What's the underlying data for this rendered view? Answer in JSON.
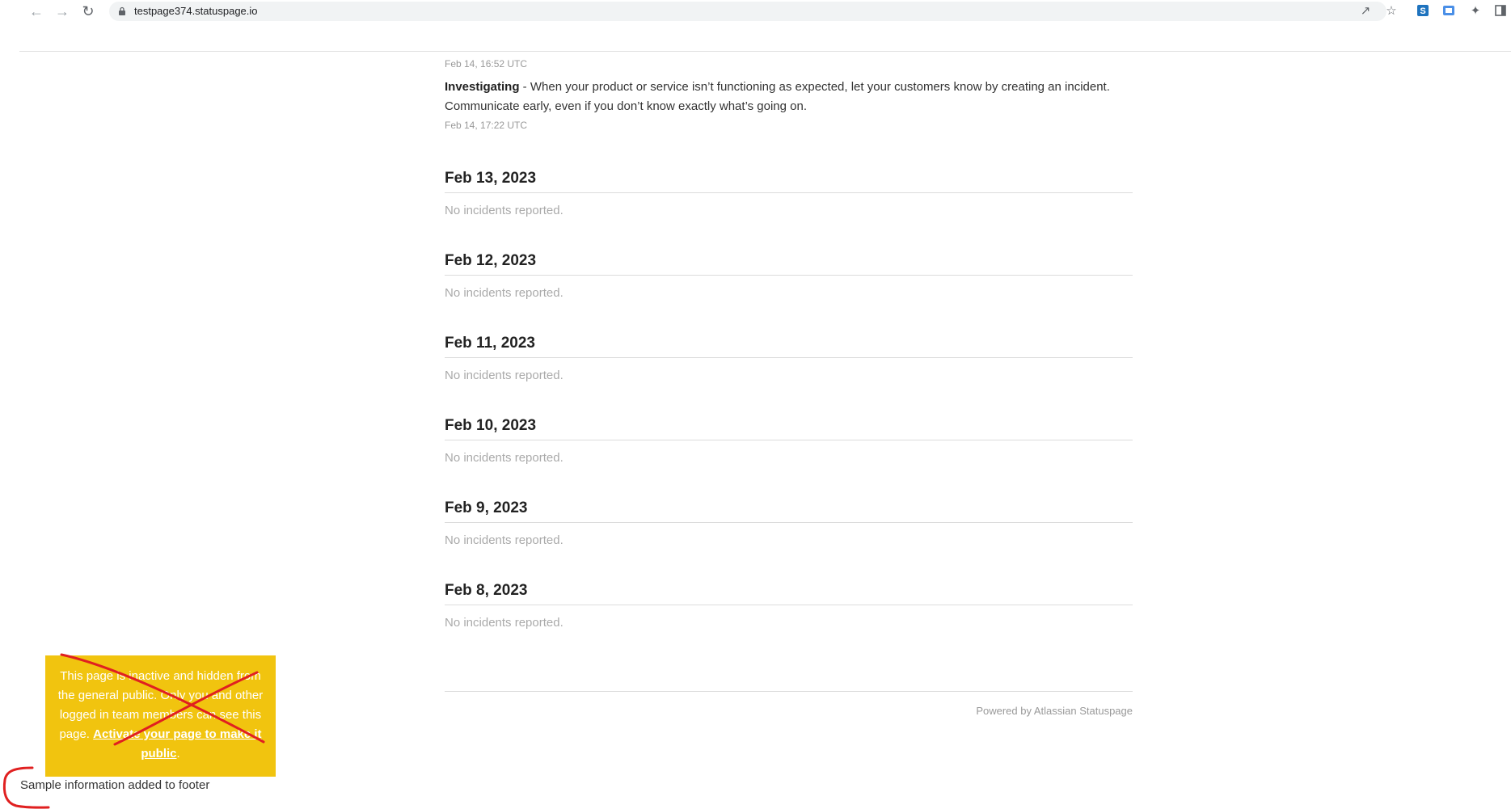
{
  "browser": {
    "back_icon": "arrow-left-icon",
    "forward_icon": "arrow-right-icon",
    "reload_icon": "reload-icon",
    "url": "testpage374.statuspage.io"
  },
  "incident": {
    "first_timestamp": "Feb 14, 16:52 UTC",
    "update_status": "Investigating",
    "update_separator": " - ",
    "update_text": "When your product or service isn’t functioning as expected, let your customers know by creating an incident. Communicate early, even if you don’t know exactly what’s going on.",
    "update_timestamp": "Feb 14, 17:22 UTC"
  },
  "days": [
    {
      "date": "Feb 13, 2023",
      "message": "No incidents reported."
    },
    {
      "date": "Feb 12, 2023",
      "message": "No incidents reported."
    },
    {
      "date": "Feb 11, 2023",
      "message": "No incidents reported."
    },
    {
      "date": "Feb 10, 2023",
      "message": "No incidents reported."
    },
    {
      "date": "Feb 9, 2023",
      "message": "No incidents reported."
    },
    {
      "date": "Feb 8, 2023",
      "message": "No incidents reported."
    }
  ],
  "footer": {
    "powered_by": "Powered by Atlassian Statuspage",
    "sample_info": "Sample information added to footer"
  },
  "banner": {
    "text": "This page is inactive and hidden from the general public. Only you and other logged in team members can see this page.",
    "link_text": "Activate your page to make it public",
    "trailing": "."
  },
  "colors": {
    "banner_bg": "#f1c40f",
    "annotation_red": "#e02020"
  }
}
